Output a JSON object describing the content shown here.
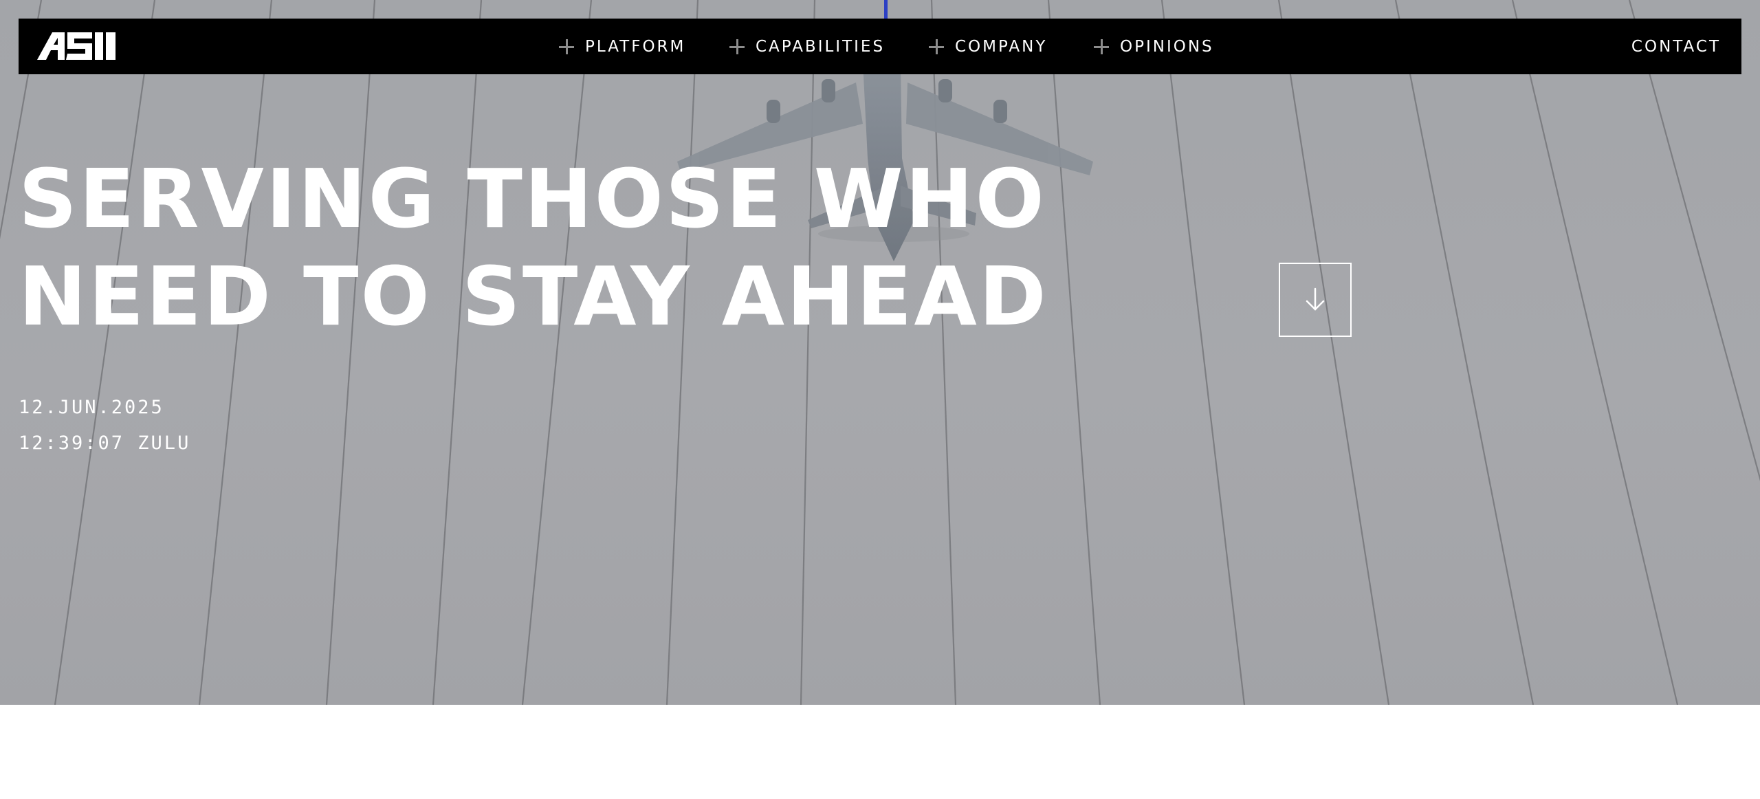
{
  "brand": {
    "logo_text": "ASI"
  },
  "nav": {
    "items": [
      {
        "label": "PLATFORM"
      },
      {
        "label": "CAPABILITIES"
      },
      {
        "label": "COMPANY"
      },
      {
        "label": "OPINIONS"
      }
    ],
    "contact_label": "CONTACT"
  },
  "hero": {
    "headline_line1": "SERVING THOSE WHO",
    "headline_line2": "NEED TO STAY AHEAD",
    "date": "12.JUN.2025",
    "time": "12:39:07 ZULU",
    "scroll_icon": "arrow-down-icon"
  },
  "colors": {
    "topbar": "#000000",
    "hero_background": "#a5a6aa",
    "text": "#ffffff",
    "accent_line": "#2b3fc4"
  }
}
